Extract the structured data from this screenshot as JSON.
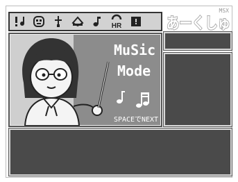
{
  "toolbar": {
    "buttons": [
      {
        "icon": "exclamation-note-icon",
        "label": "!"
      },
      {
        "icon": "face-icon",
        "label": ""
      },
      {
        "icon": "sword-icon",
        "label": ""
      },
      {
        "icon": "book-icon",
        "label": ""
      },
      {
        "icon": "music-note-icon",
        "label": ""
      },
      {
        "icon": "hr-icon",
        "label": "HR"
      },
      {
        "icon": "info-icon",
        "label": "!"
      }
    ]
  },
  "logo": {
    "text": "あーくしゅ",
    "badge": "MSX"
  },
  "scene": {
    "title_line1": "MuSic",
    "title_line2": "Mode",
    "hint": "SPACEでNEXT"
  },
  "panels": {
    "side_top": "",
    "side_main": "",
    "message": ""
  },
  "colors": {
    "panel": "#4a4a4a",
    "border": "#d8d8d8",
    "scene_bg": "#cfcfcf"
  }
}
